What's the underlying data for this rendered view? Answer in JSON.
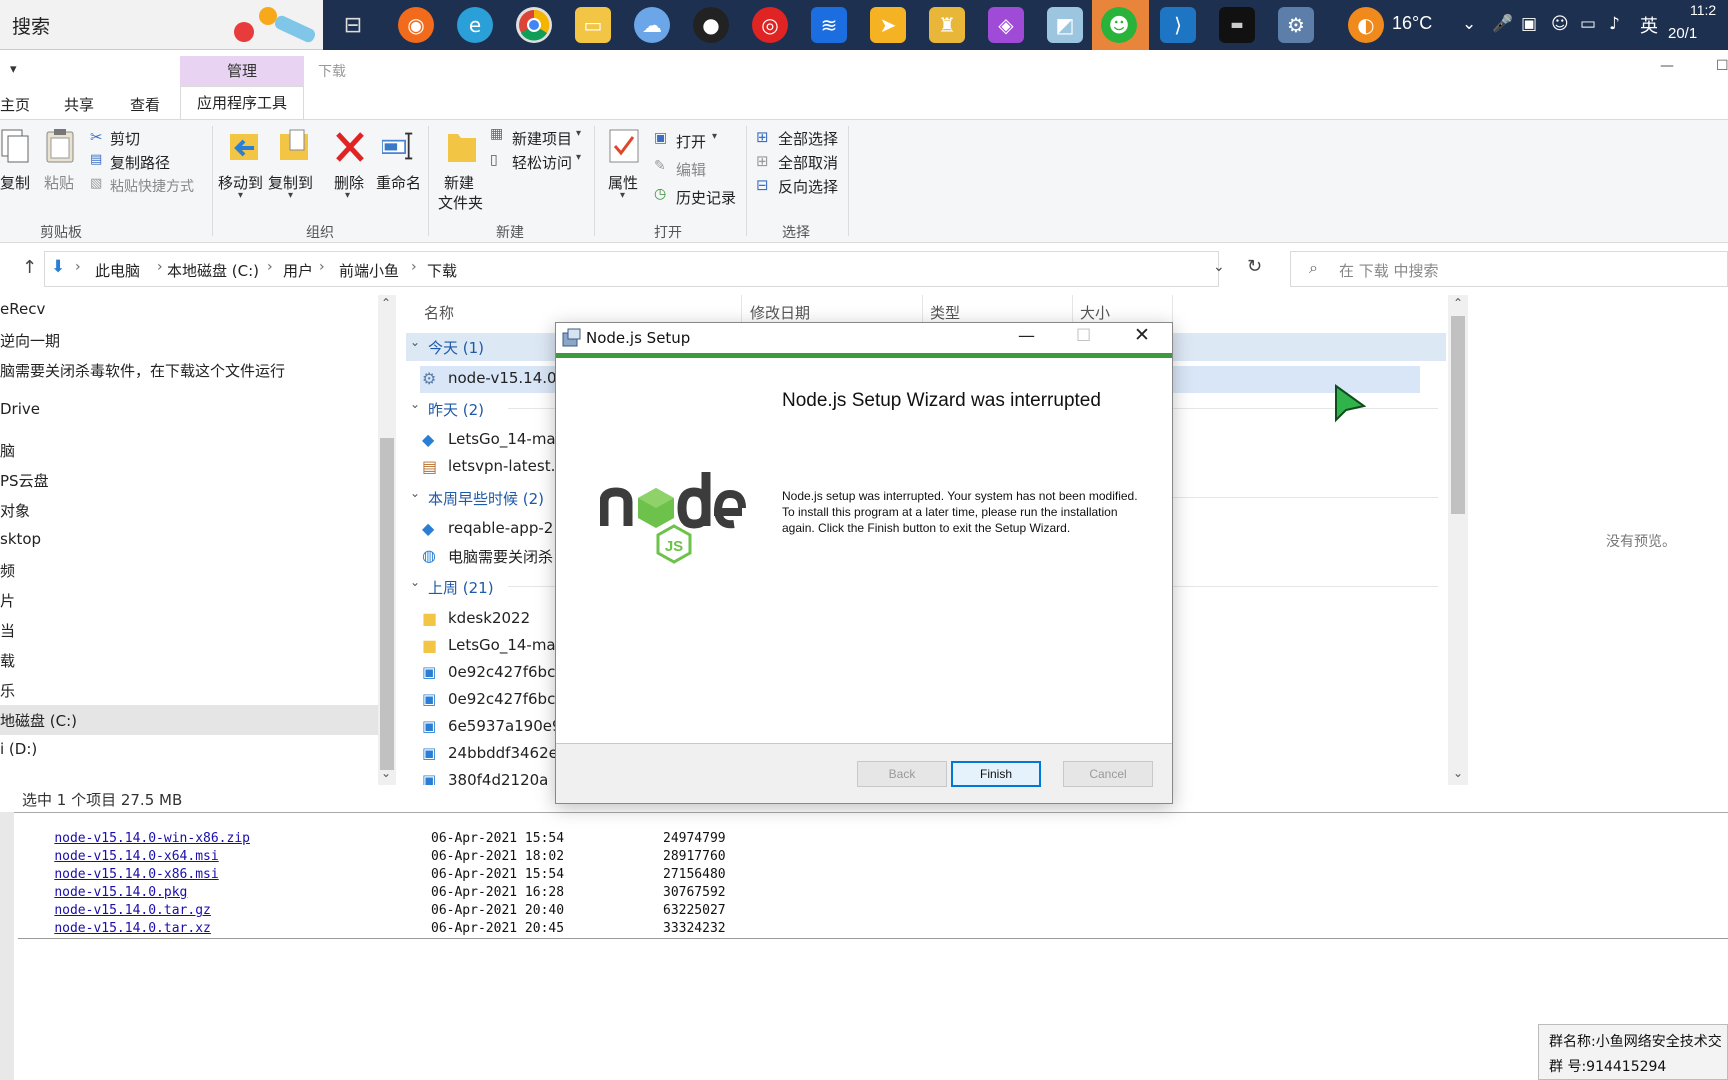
{
  "taskbar": {
    "search_text": "搜索",
    "weather_temp": "16°C",
    "ime_label": "英",
    "clock_time": "11:2",
    "clock_date": "20/1"
  },
  "ribbon": {
    "tab_manage": "管理",
    "tab_download": "下载",
    "tab_home": "主页",
    "tab_share": "共享",
    "tab_view": "查看",
    "tab_apptools": "应用程序工具",
    "clipboard": {
      "copy": "复制",
      "paste": "粘贴",
      "cut": "剪切",
      "copy_path": "复制路径",
      "paste_shortcut": "粘贴快捷方式",
      "group": "剪贴板"
    },
    "organize": {
      "move_to": "移动到",
      "copy_to": "复制到",
      "delete": "删除",
      "rename": "重命名",
      "group": "组织"
    },
    "new": {
      "new_folder_1": "新建",
      "new_folder_2": "文件夹",
      "new_item": "新建项目",
      "easy_access": "轻松访问",
      "group": "新建"
    },
    "open": {
      "properties": "属性",
      "open": "打开",
      "edit": "编辑",
      "history": "历史记录",
      "group": "打开"
    },
    "select": {
      "select_all": "全部选择",
      "select_none": "全部取消",
      "invert": "反向选择",
      "group": "选择"
    }
  },
  "address": {
    "crumbs": [
      "此电脑",
      "本地磁盘 (C:)",
      "用户",
      "前端小鱼",
      "下载"
    ],
    "search_placeholder": "在 下载 中搜索"
  },
  "nav": {
    "items": [
      "eRecv",
      "逆向一期",
      "脑需要关闭杀毒软件，在下载这个文件运行",
      "Drive",
      "脑",
      "PS云盘",
      "对象",
      "sktop",
      "频",
      "片",
      "当",
      "载",
      "乐",
      "地磁盘 (C:)",
      "i (D:)"
    ]
  },
  "files": {
    "columns": [
      "名称",
      "修改日期",
      "类型",
      "大小"
    ],
    "groups": [
      {
        "label": "今天 (1)",
        "items": [
          "node-v15.14.0"
        ]
      },
      {
        "label": "昨天 (2)",
        "items": [
          "LetsGo_14-ma",
          "letsvpn-latest."
        ]
      },
      {
        "label": "本周早些时候 (2)",
        "items": [
          "reqable-app-2",
          "电脑需要关闭杀"
        ]
      },
      {
        "label": "上周 (21)",
        "items": [
          "kdesk2022",
          "LetsGo_14-ma",
          "0e92c427f6bc",
          "0e92c427f6bc",
          "6e5937a190e9",
          "24bbddf3462e",
          "380f4d2120a"
        ]
      }
    ],
    "no_preview": "没有预览。",
    "status": "选中 1 个项目  27.5 MB"
  },
  "listing": {
    "rows": [
      {
        "name": "node-v15.14.0-win-x86.zip",
        "date": "06-Apr-2021 15:54",
        "size": "24974799"
      },
      {
        "name": "node-v15.14.0-x64.msi",
        "date": "06-Apr-2021 18:02",
        "size": "28917760"
      },
      {
        "name": "node-v15.14.0-x86.msi",
        "date": "06-Apr-2021 15:54",
        "size": "27156480"
      },
      {
        "name": "node-v15.14.0.pkg",
        "date": "06-Apr-2021 16:28",
        "size": "30767592"
      },
      {
        "name": "node-v15.14.0.tar.gz",
        "date": "06-Apr-2021 20:40",
        "size": "63225027"
      },
      {
        "name": "node-v15.14.0.tar.xz",
        "date": "06-Apr-2021 20:45",
        "size": "33324232"
      }
    ]
  },
  "chat_popup": {
    "line1": "群名称:小鱼网络安全技术交",
    "line2": "群  号:914415294"
  },
  "dialog": {
    "title": "Node.js Setup",
    "heading": "Node.js Setup Wizard was interrupted",
    "message": "Node.js setup was interrupted. Your system has not been modified. To install this program at a later time, please run the installation again. Click the Finish button to exit the Setup Wizard.",
    "back": "Back",
    "finish": "Finish",
    "cancel": "Cancel"
  },
  "colors": {
    "taskbar": "#1e3050",
    "accent_green": "#3d9a3f",
    "selection": "#d9e6f7",
    "link": "#1a0dab",
    "primary_button": "#0078d7"
  }
}
